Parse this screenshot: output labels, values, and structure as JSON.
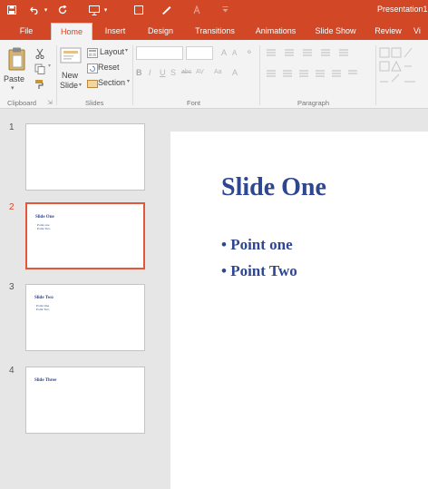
{
  "window": {
    "title": "Presentation1"
  },
  "quick_access": {
    "save_icon": "save-icon",
    "undo_icon": "undo-icon",
    "redo_icon": "redo-icon",
    "start_icon": "start-from-beginning-icon"
  },
  "tabs": [
    "File",
    "Home",
    "Insert",
    "Design",
    "Transitions",
    "Animations",
    "Slide Show",
    "Review",
    "Vi"
  ],
  "active_tab": "Home",
  "ribbon": {
    "clipboard": {
      "paste": "Paste",
      "group_label": "Clipboard"
    },
    "slides": {
      "new_slide_line1": "New",
      "new_slide_line2": "Slide",
      "layout": "Layout",
      "reset": "Reset",
      "section": "Section",
      "group_label": "Slides"
    },
    "font": {
      "group_label": "Font"
    },
    "paragraph": {
      "group_label": "Paragraph"
    }
  },
  "slides": [
    {
      "number": "1",
      "title": "",
      "bullets": []
    },
    {
      "number": "2",
      "title": "Slide One",
      "bullets": [
        "Point one",
        "Point Two"
      ]
    },
    {
      "number": "3",
      "title": "Slide Two",
      "bullets": [
        "Point One",
        "Point Two"
      ]
    },
    {
      "number": "4",
      "title": "Slide Three",
      "bullets": []
    }
  ],
  "selected_slide": 2,
  "current_slide": {
    "title": "Slide One",
    "bullets": [
      "Point one",
      "Point Two"
    ]
  },
  "colors": {
    "accent": "#D24726",
    "slide_text": "#2F4690"
  }
}
